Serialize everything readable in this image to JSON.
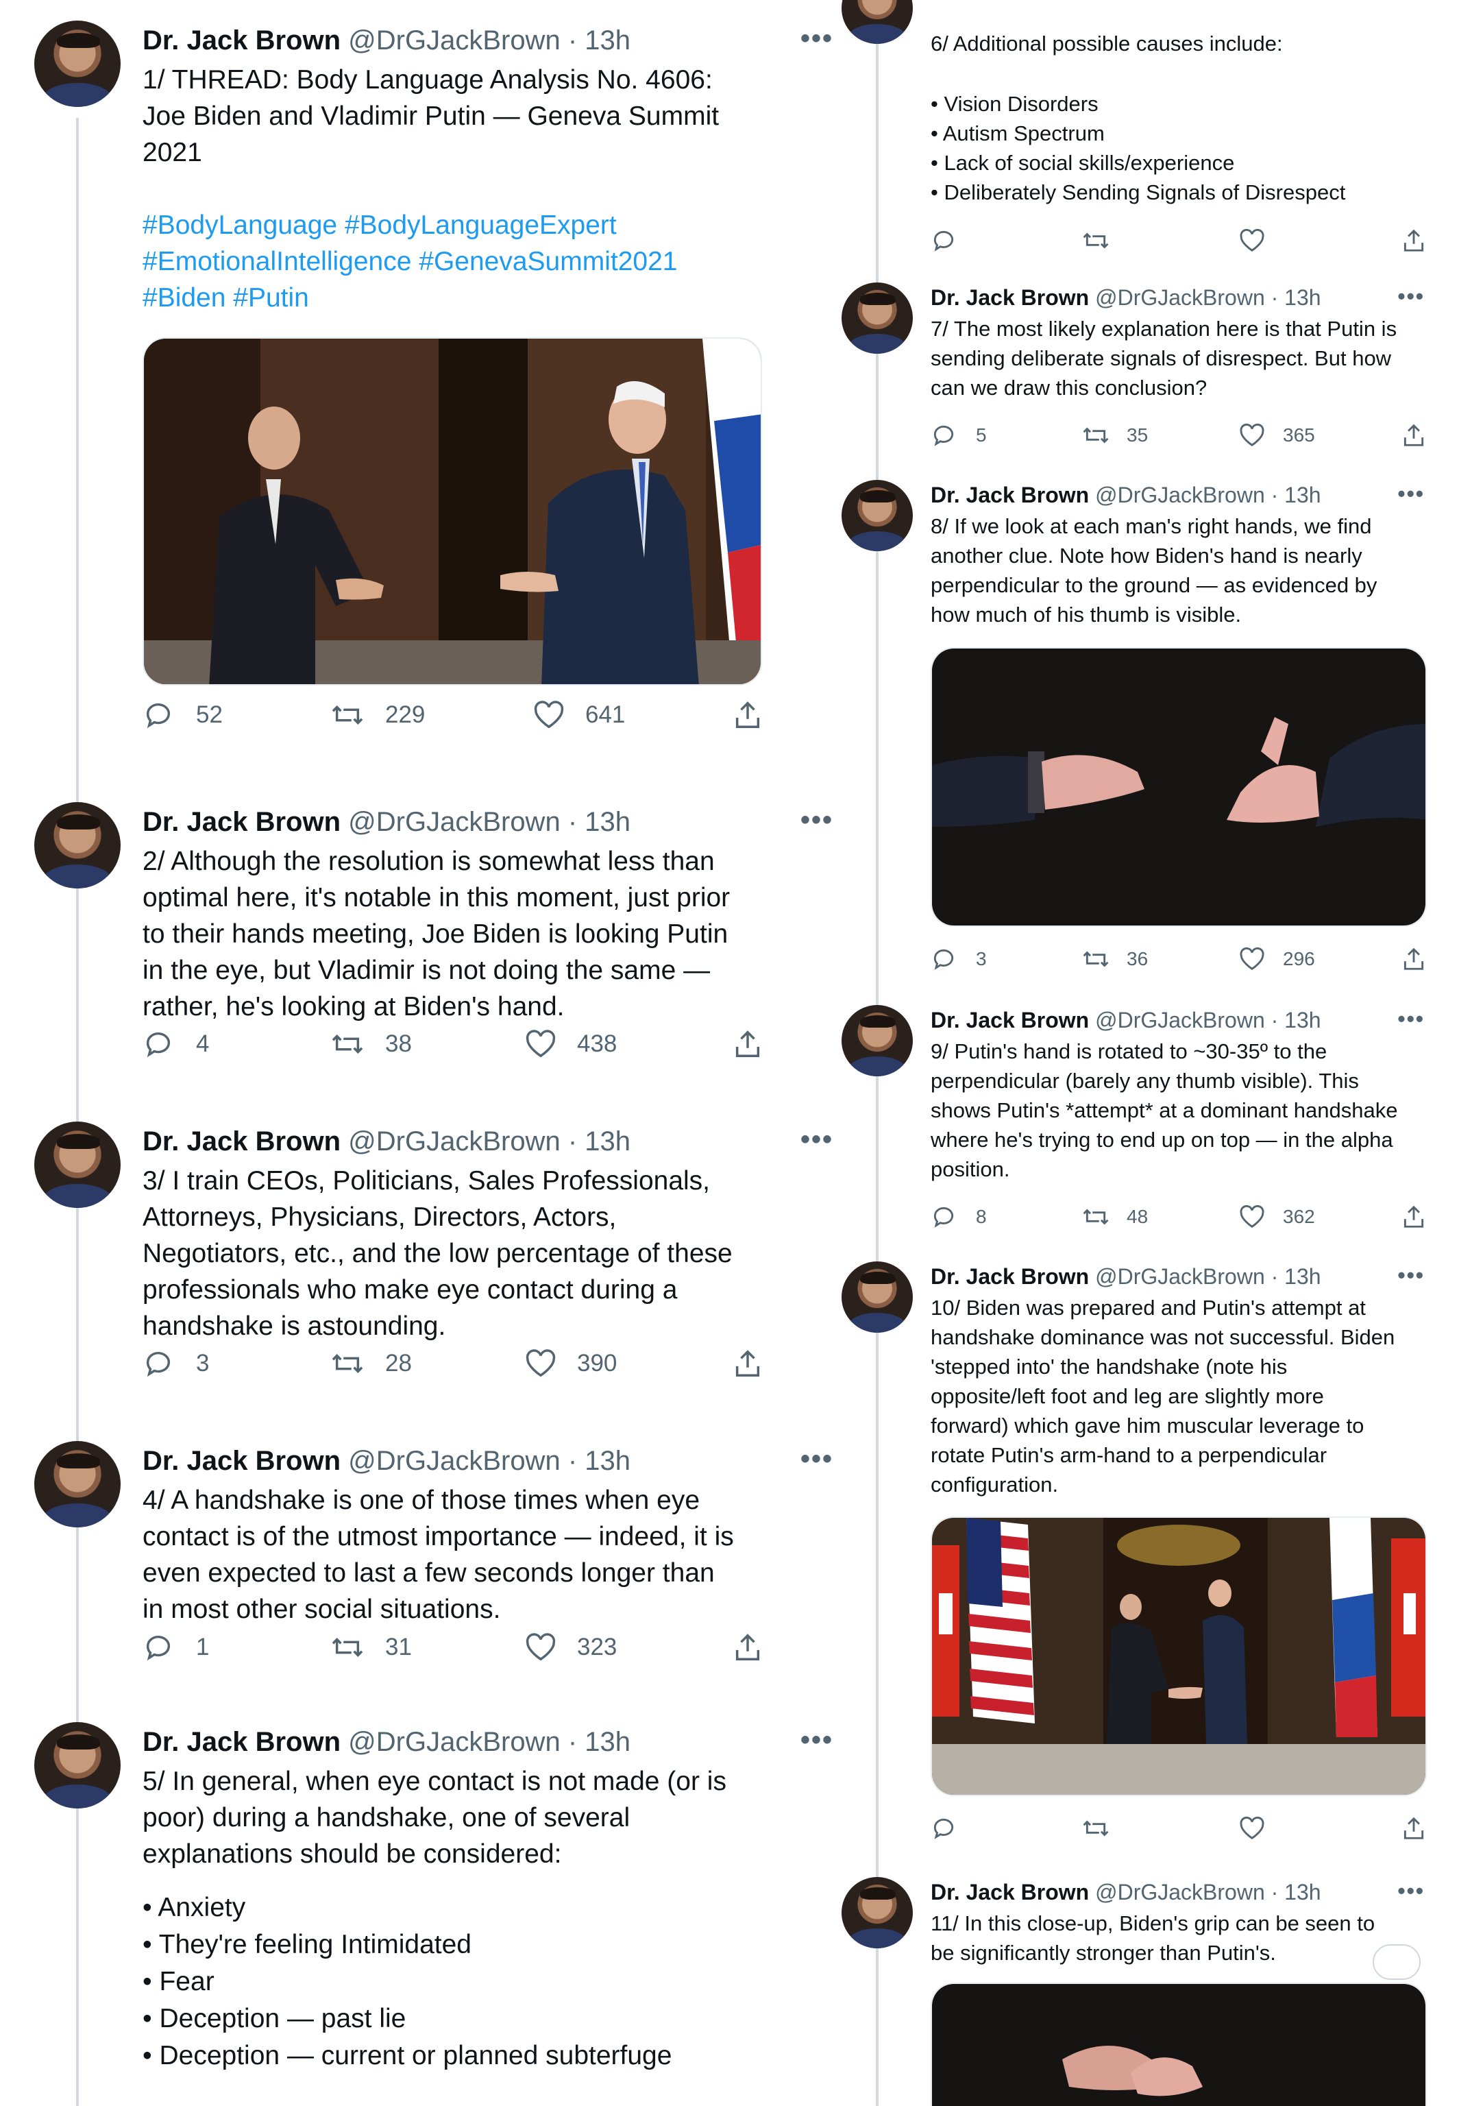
{
  "author": {
    "name": "Dr. Jack Brown",
    "handle": "@DrGJackBrown",
    "time": "· 13h",
    "more": "•••"
  },
  "tweets": [
    {
      "text": "1/  THREAD:  Body Language Analysis No. 4606:\nJoe Biden and Vladimir Putin — Geneva Summit\n2021",
      "hashtags": "#BodyLanguage #BodyLanguageExpert\n#EmotionalIntelligence #GenevaSummit2021\n#Biden #Putin",
      "photo": "Biden and Putin handshake at villa doorway",
      "replies": "52",
      "retweets": "229",
      "likes": "641"
    },
    {
      "text": "2/  Although the resolution is somewhat less than\noptimal here, it's notable in this moment, just prior\nto their hands meeting, Joe Biden is looking Putin\nin the eye, but Vladimir is not doing the same —\nrather, he's looking at Biden's hand.",
      "replies": "4",
      "retweets": "38",
      "likes": "438"
    },
    {
      "text": "3/  I train CEOs, Politicians, Sales Professionals,\nAttorneys, Physicians, Directors, Actors,\nNegotiators, etc., and the low percentage of these\nprofessionals who make eye contact during a\nhandshake is astounding.",
      "replies": "3",
      "retweets": "28",
      "likes": "390"
    },
    {
      "text": "4/  A handshake is one of those times when eye\ncontact is of the utmost importance — indeed, it is\neven expected to last a few seconds longer than\nin most other social situations.",
      "replies": "1",
      "retweets": "31",
      "likes": "323"
    },
    {
      "text": "5/  In general, when eye contact is not made (or is\npoor) during a handshake, one of several\nexplanations should be considered:",
      "bullets": [
        "• Anxiety",
        "• They're feeling Intimidated",
        "• Fear",
        "• Deception — past lie",
        "• Deception — current or planned subterfuge"
      ]
    },
    {
      "text": "6/  Additional possible causes include:",
      "bullets": [
        "• Vision Disorders",
        "• Autism Spectrum",
        "• Lack of social skills/experience",
        "• Deliberately Sending Signals of Disrespect"
      ]
    },
    {
      "text": "7/  The most likely explanation here is that Putin is\nsending deliberate signals of disrespect. But how\ncan we draw this conclusion?",
      "replies": "5",
      "retweets": "35",
      "likes": "365"
    },
    {
      "text": "8/  If we look at each man's right hands, we find\nanother clue. Note how Biden's hand is nearly\nperpendicular to the ground — as evidenced by\nhow much of his thumb is visible.",
      "photo": "Close-up of two right hands about to meet",
      "replies": "3",
      "retweets": "36",
      "likes": "296"
    },
    {
      "text": "9/  Putin's hand is rotated to ~30-35º to the\nperpendicular (barely any thumb visible). This\nshows Putin's *attempt* at a dominant handshake\nwhere he's trying to end up on top — in the alpha\nposition.",
      "replies": "8",
      "retweets": "48",
      "likes": "362"
    },
    {
      "text": "10/  Biden was prepared and Putin's attempt at\nhandshake dominance was not successful. Biden\n'stepped into' the handshake (note his\nopposite/left foot and leg are slightly more\nforward) which gave him muscular leverage to\nrotate Putin's arm-hand to a perpendicular\nconfiguration.",
      "photo": "Biden and Putin shaking hands between US, Swiss and Russian flags",
      "replies": "",
      "retweets": "",
      "likes": ""
    },
    {
      "text": "11/  In this close-up, Biden's grip can be seen to\nbe significantly stronger than Putin's.",
      "photo": "Close-up of the handshake grip"
    }
  ],
  "icons": {
    "reply": "reply-icon",
    "retweet": "retweet-icon",
    "like": "heart-icon",
    "share": "share-icon"
  },
  "colors": {
    "hashtag": "#1d9bf0",
    "secondary": "#536471",
    "thread_line": "#cfd9de"
  }
}
